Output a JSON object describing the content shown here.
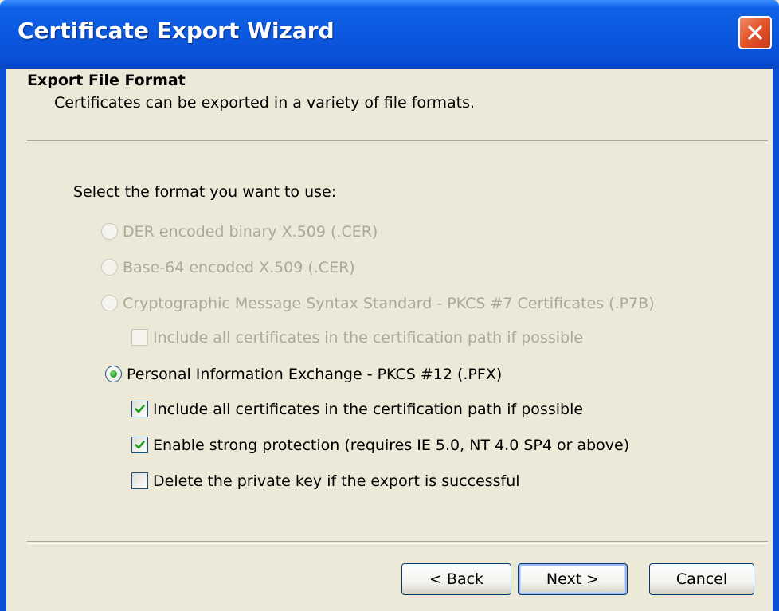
{
  "window": {
    "title": "Certificate Export Wizard",
    "close_icon": "close-icon"
  },
  "header": {
    "heading": "Export File Format",
    "subheading": "Certificates can be exported in a variety of file formats."
  },
  "main": {
    "prompt": "Select the format you want to use:",
    "options": [
      {
        "type": "radio",
        "label": "DER encoded binary X.509 (.CER)",
        "checked": false,
        "enabled": false
      },
      {
        "type": "radio",
        "label": "Base-64 encoded X.509 (.CER)",
        "checked": false,
        "enabled": false
      },
      {
        "type": "radio",
        "label": "Cryptographic Message Syntax Standard - PKCS #7 Certificates (.P7B)",
        "checked": false,
        "enabled": false
      },
      {
        "type": "checkbox",
        "label": "Include all certificates in the certification path if possible",
        "checked": false,
        "enabled": false
      },
      {
        "type": "radio",
        "label": "Personal Information Exchange - PKCS #12 (.PFX)",
        "checked": true,
        "enabled": true
      },
      {
        "type": "checkbox",
        "label": "Include all certificates in the certification path if possible",
        "checked": true,
        "enabled": true
      },
      {
        "type": "checkbox",
        "label": "Enable strong protection (requires IE 5.0, NT 4.0 SP4 or above)",
        "checked": true,
        "enabled": true
      },
      {
        "type": "checkbox",
        "label": "Delete the private key if the export is successful",
        "checked": false,
        "enabled": true
      }
    ]
  },
  "footer": {
    "back_label": "< Back",
    "next_label": "Next >",
    "cancel_label": "Cancel"
  },
  "colors": {
    "title_bar": "#0a4fd6",
    "dialog_bg": "#ece9d8",
    "disabled_text": "#aca899",
    "check_green": "#21a121",
    "close_red": "#e4572e"
  }
}
